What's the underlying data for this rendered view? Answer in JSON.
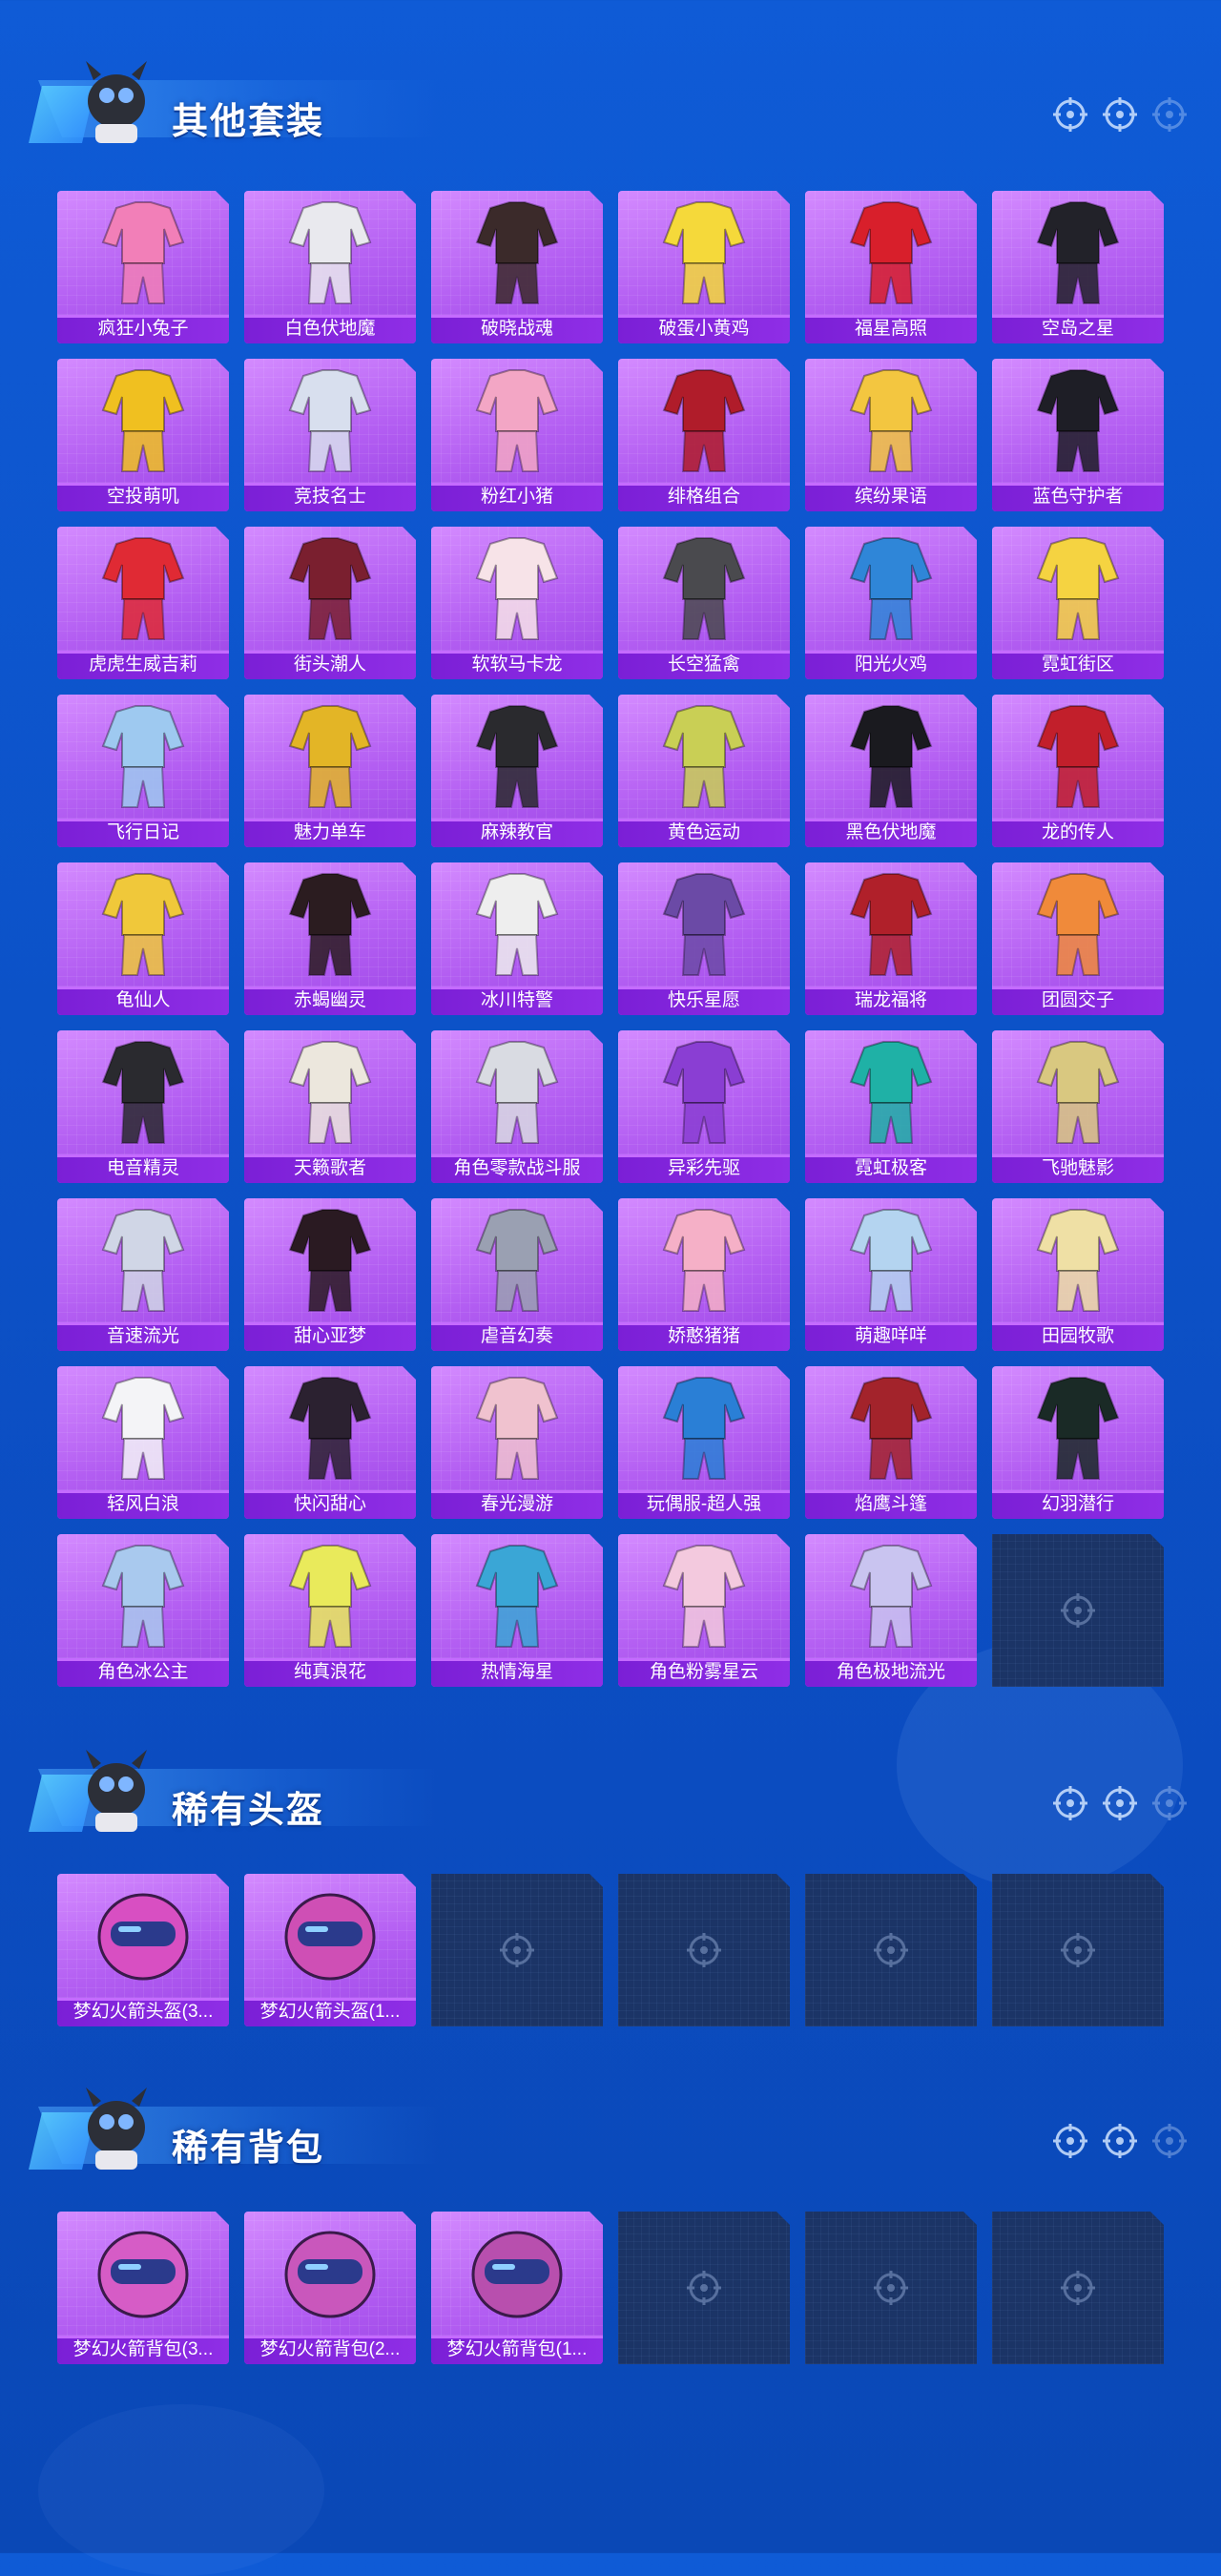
{
  "colors": {
    "background": "#0c52c8",
    "card_purple": "#b35ef2",
    "label_purple": "#7b1fd6",
    "empty_slot": "#1b3466",
    "title_text": "#ffffff"
  },
  "sections": [
    {
      "title": "其他套装",
      "items": [
        {
          "label": "疯狂小兔子",
          "icon": "outfit-pink-bunny",
          "color": "#f27fb8"
        },
        {
          "label": "白色伏地魔",
          "icon": "outfit-white-hoodie",
          "color": "#e9e9ee"
        },
        {
          "label": "破晓战魂",
          "icon": "outfit-dark-cloak",
          "color": "#3b2a2a"
        },
        {
          "label": "破蛋小黄鸡",
          "icon": "outfit-yellow-chick",
          "color": "#f5d93a"
        },
        {
          "label": "福星高照",
          "icon": "outfit-red-suit",
          "color": "#d81f2b"
        },
        {
          "label": "空岛之星",
          "icon": "outfit-black-gear",
          "color": "#222229"
        },
        {
          "label": "空投萌叽",
          "icon": "outfit-yellow-jumpsuit",
          "color": "#f0c020"
        },
        {
          "label": "竞技名士",
          "icon": "outfit-white-jacket",
          "color": "#d8dfee"
        },
        {
          "label": "粉红小猪",
          "icon": "outfit-pink-pig",
          "color": "#f3a6c5"
        },
        {
          "label": "绯格组合",
          "icon": "outfit-plaid-set",
          "color": "#b01c2a"
        },
        {
          "label": "缤纷果语",
          "icon": "outfit-fruit-dress",
          "color": "#f3c640"
        },
        {
          "label": "蓝色守护者",
          "icon": "outfit-black-guard",
          "color": "#1e1e26"
        },
        {
          "label": "虎虎生威吉莉",
          "icon": "outfit-red-white-suit",
          "color": "#e02a34"
        },
        {
          "label": "街头潮人",
          "icon": "outfit-puffer-jacket",
          "color": "#7a1f2f"
        },
        {
          "label": "软软马卡龙",
          "icon": "outfit-pastel-set",
          "color": "#f7e3e8"
        },
        {
          "label": "长空猛禽",
          "icon": "outfit-camo-jacket",
          "color": "#4a4a4e"
        },
        {
          "label": "阳光火鸡",
          "icon": "outfit-blue-yellow-cowboy",
          "color": "#2f86d8"
        },
        {
          "label": "霓虹街区",
          "icon": "outfit-neon-street",
          "color": "#f5d341"
        },
        {
          "label": "飞行日记",
          "icon": "outfit-pastel-bomber",
          "color": "#9ec9f0"
        },
        {
          "label": "魅力单车",
          "icon": "outfit-yellow-shirt",
          "color": "#e3b526"
        },
        {
          "label": "麻辣教官",
          "icon": "outfit-instructor",
          "color": "#2a2a2e"
        },
        {
          "label": "黄色运动",
          "icon": "outfit-yellow-sport",
          "color": "#c9cf55"
        },
        {
          "label": "黑色伏地魔",
          "icon": "outfit-black-hoodie",
          "color": "#1a1a1f"
        },
        {
          "label": "龙的传人",
          "icon": "outfit-qipao-red",
          "color": "#c21f2b"
        },
        {
          "label": "龟仙人",
          "icon": "outfit-turtle-shirt",
          "color": "#f0c83a"
        },
        {
          "label": "赤蝎幽灵",
          "icon": "outfit-scorpion-jacket",
          "color": "#2b1c20"
        },
        {
          "label": "冰川特警",
          "icon": "outfit-white-police",
          "color": "#eeeeee"
        },
        {
          "label": "快乐星愿",
          "icon": "outfit-mech-purple",
          "color": "#6b4aa6"
        },
        {
          "label": "瑞龙福将",
          "icon": "outfit-dragon-armor",
          "color": "#b0202a"
        },
        {
          "label": "团圆交子",
          "icon": "outfit-orange-hanfu",
          "color": "#f08a3a"
        },
        {
          "label": "电音精灵",
          "icon": "outfit-black-trench",
          "color": "#2a2a2f"
        },
        {
          "label": "天籁歌者",
          "icon": "outfit-white-coat",
          "color": "#ece7dd"
        },
        {
          "label": "角色零款战斗服",
          "icon": "outfit-base-suit",
          "color": "#d9dbe2"
        },
        {
          "label": "异彩先驱",
          "icon": "outfit-colorful-armor",
          "color": "#8a3ed3"
        },
        {
          "label": "霓虹极客",
          "icon": "outfit-teal-pink",
          "color": "#1fb1a6"
        },
        {
          "label": "飞驰魅影",
          "icon": "outfit-gold-white",
          "color": "#d9c880"
        },
        {
          "label": "音速流光",
          "icon": "outfit-silver-white",
          "color": "#d0d6e6"
        },
        {
          "label": "甜心亚梦",
          "icon": "outfit-black-pink",
          "color": "#2a1a22"
        },
        {
          "label": "虐音幻奏",
          "icon": "outfit-plaid-grey",
          "color": "#9aa0b2"
        },
        {
          "label": "娇憨猪猪",
          "icon": "outfit-pink-pig-set",
          "color": "#f5b0c7"
        },
        {
          "label": "萌趣咩咩",
          "icon": "outfit-blue-sheep",
          "color": "#b4d4f0"
        },
        {
          "label": "田园牧歌",
          "icon": "outfit-cream-dress",
          "color": "#efe0a5"
        },
        {
          "label": "轻风白浪",
          "icon": "outfit-white-lace",
          "color": "#f4f4f7"
        },
        {
          "label": "快闪甜心",
          "icon": "outfit-heart-jacket",
          "color": "#2b2130"
        },
        {
          "label": "春光漫游",
          "icon": "outfit-pink-coat",
          "color": "#f0c2cf"
        },
        {
          "label": "玩偶服-超人强",
          "icon": "outfit-mascot-blue",
          "color": "#2a7fd6"
        },
        {
          "label": "焰鹰斗篷",
          "icon": "outfit-red-cloak",
          "color": "#a3232b"
        },
        {
          "label": "幻羽潜行",
          "icon": "outfit-black-green",
          "color": "#1a2a26"
        },
        {
          "label": "角色冰公主",
          "icon": "outfit-ice-princess",
          "color": "#a9c9ee"
        },
        {
          "label": "纯真浪花",
          "icon": "outfit-lemon-set",
          "color": "#e9ea5b"
        },
        {
          "label": "热情海星",
          "icon": "outfit-ocean-set",
          "color": "#3aa6d6"
        },
        {
          "label": "角色粉雾星云",
          "icon": "outfit-pink-nebula",
          "color": "#f3c9de"
        },
        {
          "label": "角色极地流光",
          "icon": "outfit-polar-dress",
          "color": "#c9c4f0"
        }
      ],
      "empty_slots": 1
    },
    {
      "title": "稀有头盔",
      "items": [
        {
          "label": "梦幻火箭头盔(3...",
          "icon": "helmet-rocket-lv3",
          "color": "#d84fc2"
        },
        {
          "label": "梦幻火箭头盔(1...",
          "icon": "helmet-rocket-lv1",
          "color": "#cf4fb5"
        }
      ],
      "empty_slots": 4
    },
    {
      "title": "稀有背包",
      "items": [
        {
          "label": "梦幻火箭背包(3...",
          "icon": "backpack-rocket-lv3",
          "color": "#d65cc6"
        },
        {
          "label": "梦幻火箭背包(2...",
          "icon": "backpack-rocket-lv2",
          "color": "#c957bc"
        },
        {
          "label": "梦幻火箭背包(1...",
          "icon": "backpack-rocket-lv1",
          "color": "#b84fae"
        }
      ],
      "empty_slots": 3
    }
  ]
}
